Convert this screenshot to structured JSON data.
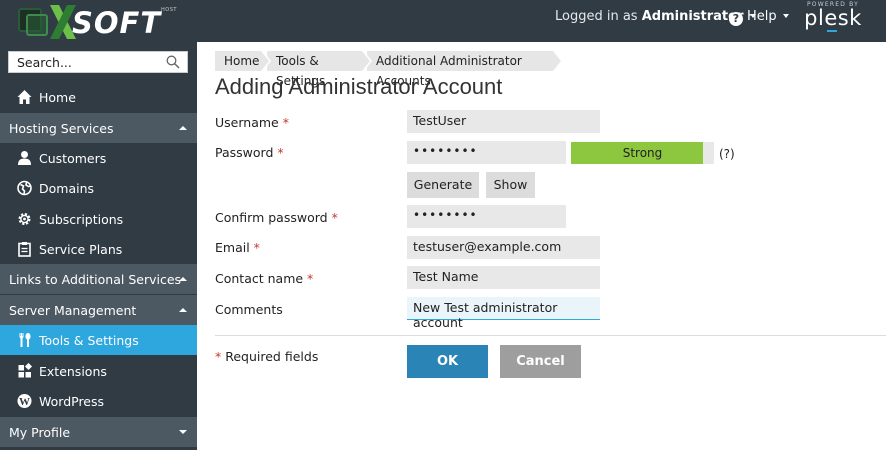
{
  "header": {
    "logo_text": "SOFT",
    "logo_sub": "HOST",
    "logged_in_prefix": "Logged in as",
    "user_name": "Administrator",
    "help_label": "Help",
    "powered_by": "POWERED BY",
    "powered_brand": "plesk"
  },
  "sidebar": {
    "search_placeholder": "Search...",
    "items": [
      {
        "label": "Home",
        "icon": "home-icon"
      },
      {
        "label": "Hosting Services",
        "type": "group",
        "expanded": true
      },
      {
        "label": "Customers",
        "icon": "user-icon"
      },
      {
        "label": "Domains",
        "icon": "globe-icon"
      },
      {
        "label": "Subscriptions",
        "icon": "gear-icon"
      },
      {
        "label": "Service Plans",
        "icon": "clipboard-icon"
      },
      {
        "label": "Links to Additional Services",
        "type": "group",
        "expanded": true
      },
      {
        "label": "Server Management",
        "type": "group",
        "expanded": true
      },
      {
        "label": "Tools & Settings",
        "icon": "tools-icon",
        "active": true
      },
      {
        "label": "Extensions",
        "icon": "puzzle-icon"
      },
      {
        "label": "WordPress",
        "icon": "wordpress-icon"
      },
      {
        "label": "My Profile",
        "type": "group",
        "expanded": false
      }
    ]
  },
  "breadcrumbs": [
    "Home",
    "Tools & Settings",
    "Additional Administrator Accounts"
  ],
  "page_title": "Adding Administrator Account",
  "form": {
    "required_marker": "*",
    "username_label": "Username",
    "username_value": "TestUser",
    "password_label": "Password",
    "password_value": "••••••••",
    "strength_label": "Strong",
    "strength_level": 0.92,
    "strength_help": "(?)",
    "generate_label": "Generate",
    "show_label": "Show",
    "confirm_label": "Confirm password",
    "confirm_value": "••••••••",
    "email_label": "Email",
    "email_value": "testuser@example.com",
    "contact_label": "Contact name",
    "contact_value": "Test Name",
    "comments_label": "Comments",
    "comments_value": "New Test administrator account",
    "required_note": "Required fields",
    "ok_label": "OK",
    "cancel_label": "Cancel"
  },
  "colors": {
    "header_bg": "#303b44",
    "group_bg": "#4c5862",
    "active_bg": "#2ea7de",
    "strength_green": "#8dc63f",
    "ok_blue": "#2a84b5",
    "cancel_gray": "#9e9e9e"
  }
}
